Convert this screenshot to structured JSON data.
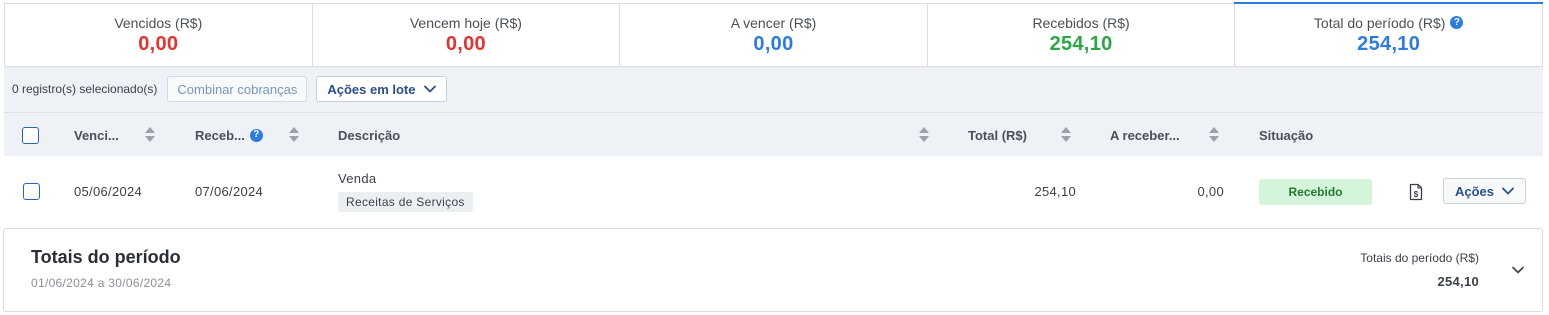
{
  "summary": [
    {
      "label": "Vencidos (R$)",
      "value": "0,00",
      "color": "#e5322d"
    },
    {
      "label": "Vencem hoje (R$)",
      "value": "0,00",
      "color": "#e5322d"
    },
    {
      "label": "A vencer (R$)",
      "value": "0,00",
      "color": "#2b7be0"
    },
    {
      "label": "Recebidos (R$)",
      "value": "254,10",
      "color": "#29a843"
    },
    {
      "label": "Total do período (R$)",
      "value": "254,10",
      "color": "#2b7be0",
      "help_icon": "help-icon"
    }
  ],
  "toolbar": {
    "selected_count": "0 registro(s) selecionado(s)",
    "combine_label": "Combinar cobranças",
    "batch_label": "Ações em lote"
  },
  "table": {
    "columns": {
      "due": "Venci...",
      "received": "Receb...",
      "description": "Descrição",
      "total": "Total (R$)",
      "to_receive": "A receber...",
      "status": "Situação"
    },
    "rows": [
      {
        "due": "05/06/2024",
        "received": "07/06/2024",
        "description": "Venda",
        "category": "Receitas de Serviços",
        "total": "254,10",
        "to_receive": "0,00",
        "status": "Recebido",
        "actions_label": "Ações"
      }
    ]
  },
  "totals": {
    "title": "Totais do período",
    "range": "01/06/2024 a 30/06/2024",
    "label": "Totais do período (R$)",
    "value": "254,10"
  }
}
